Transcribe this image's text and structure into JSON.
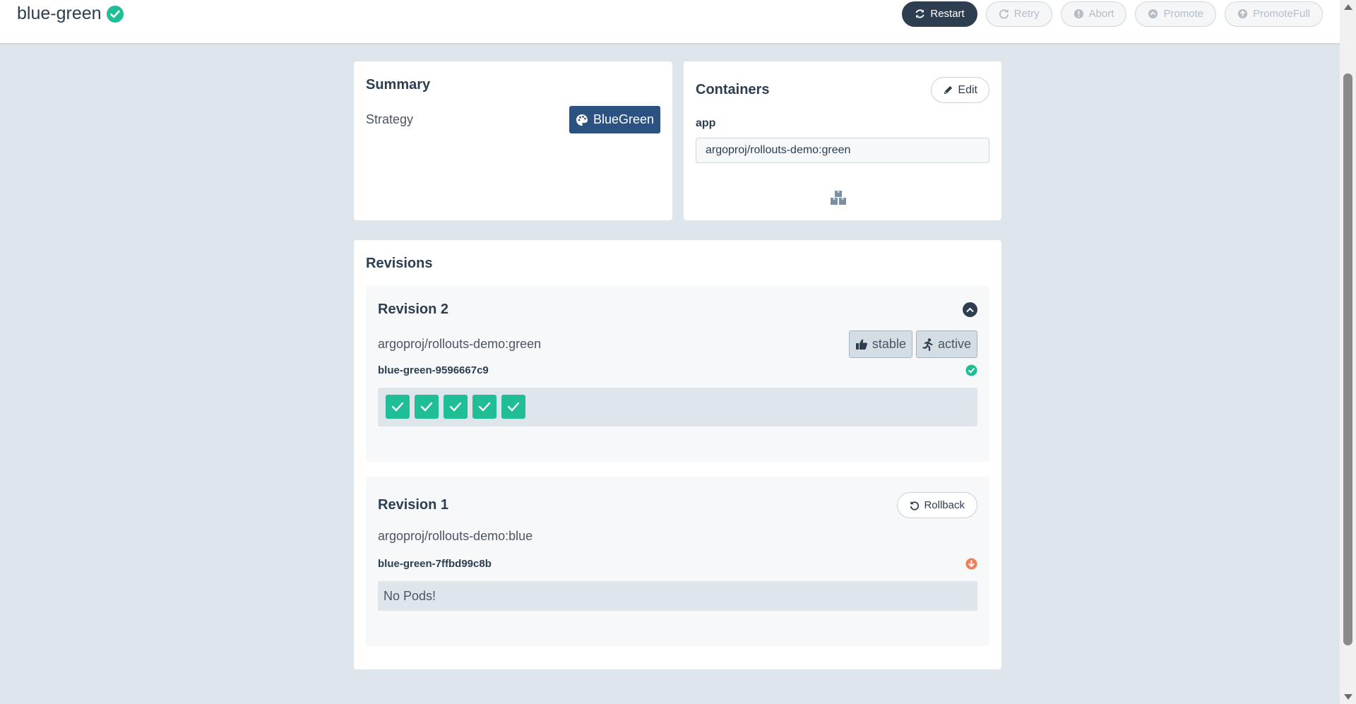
{
  "header": {
    "title": "blue-green",
    "status_icon": "check-circle-icon",
    "actions": {
      "restart": "Restart",
      "retry": "Retry",
      "abort": "Abort",
      "promote": "Promote",
      "promote_full": "PromoteFull"
    }
  },
  "summary": {
    "title": "Summary",
    "strategy_label": "Strategy",
    "strategy_value": "BlueGreen"
  },
  "containers": {
    "title": "Containers",
    "edit_label": "Edit",
    "container_name": "app",
    "container_image": "argoproj/rollouts-demo:green"
  },
  "revisions": {
    "title": "Revisions",
    "items": [
      {
        "title": "Revision 2",
        "image": "argoproj/rollouts-demo:green",
        "tags": [
          "stable",
          "active"
        ],
        "replicaset": "blue-green-9596667c9",
        "status": "healthy",
        "pods_ready": 5
      },
      {
        "title": "Revision 1",
        "image": "argoproj/rollouts-demo:blue",
        "rollback_label": "Rollback",
        "replicaset": "blue-green-7ffbd99c8b",
        "status": "scaled-down",
        "no_pods_text": "No Pods!"
      }
    ]
  },
  "colors": {
    "primary": "#2d3e50",
    "success": "#1fbe96",
    "warning": "#f07f57",
    "strategy_badge": "#2c5282",
    "background": "#dee6eb"
  }
}
